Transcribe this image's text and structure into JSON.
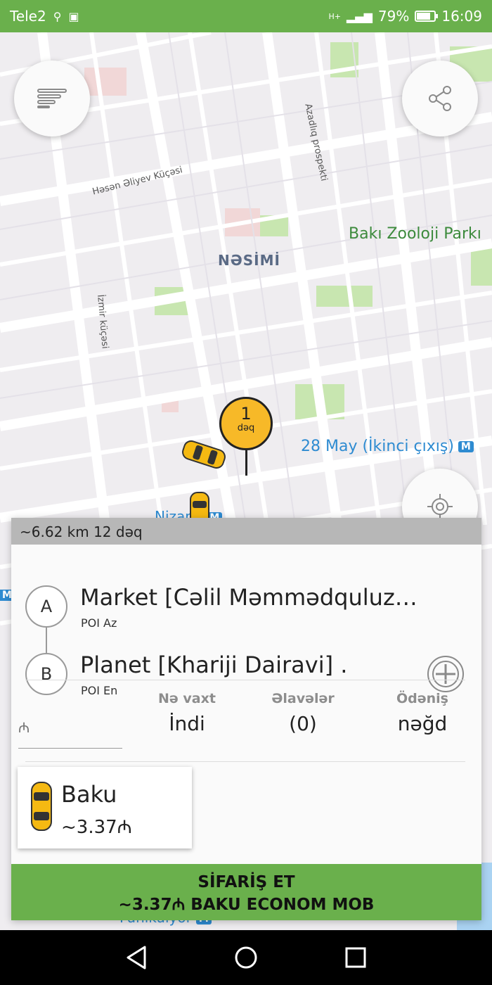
{
  "status_bar": {
    "carrier": "Tele2",
    "battery_text": "79%",
    "battery_level": 0.79,
    "time": "16:09",
    "network": "H+"
  },
  "map": {
    "district": "NƏSİMİ",
    "park": "Bakı Zooloji Parkı",
    "metro_station": "28 May (İkinci çıxış)",
    "metro_near": "Nizami",
    "metro_bottom": "Funikulyor",
    "metro_badge": "M",
    "road_1": "Azadlıq prospekti",
    "road_2": "Həsən Əliyev Küçəsi",
    "road_3": "İzmir küçəsi"
  },
  "pickup_pin": {
    "minutes": "1",
    "unit": "dəq"
  },
  "panel": {
    "trip_summary": "~6.62 km 12 dəq",
    "point_a": {
      "letter": "A",
      "title": "Market [Cəlil Məmmədquluz…",
      "subtitle": "POI Az"
    },
    "point_b": {
      "letter": "B",
      "title": "Planet [Khariji Dairavi] .",
      "subtitle": "POI En"
    },
    "currency_symbol": "₼",
    "when": {
      "label": "Nə vaxt",
      "value": "İndi"
    },
    "extras": {
      "label": "Əlavələr",
      "value": "(0)"
    },
    "payment": {
      "label": "Ödəniş",
      "value": "nəğd"
    },
    "tariff": {
      "name": "Baku",
      "price": "~3.37₼"
    },
    "order_button": {
      "line1": "SİFARİŞ ET",
      "line2": "~3.37₼ BAKU ECONOM MOB"
    }
  },
  "icons": {
    "menu": "menu-icon",
    "share": "share-icon",
    "locate": "my-location-icon",
    "add": "plus-icon",
    "taxi": "taxi-car-icon"
  },
  "colors": {
    "accent_green": "#6ab04c",
    "pin_yellow": "#f7b928",
    "metro_blue": "#2e8bd1"
  }
}
